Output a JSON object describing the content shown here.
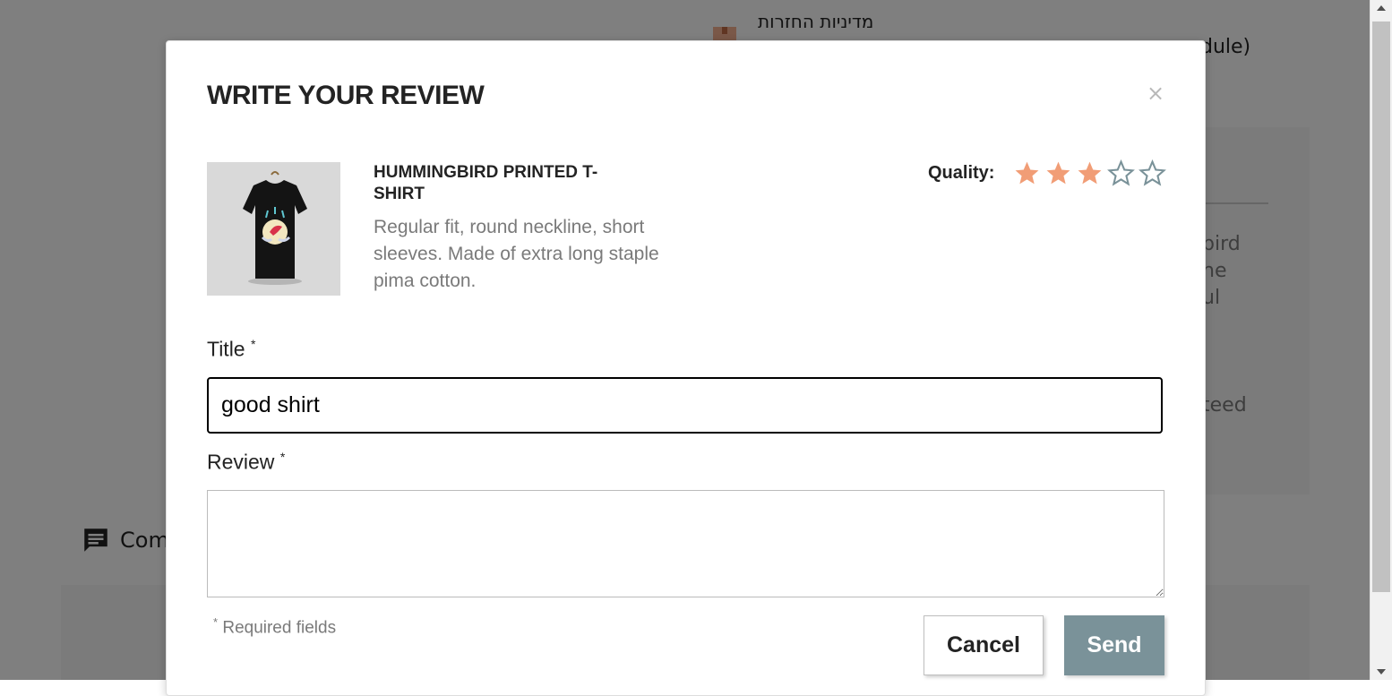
{
  "background": {
    "policy_text": "מדיניות החזרות",
    "module_text": "dule)",
    "card_text_lines": "bird\nne\nul",
    "card_text_2": "teed",
    "comments_label": "Com"
  },
  "modal": {
    "title": "WRITE YOUR REVIEW",
    "close_label": "×",
    "product": {
      "name": "HUMMINGBIRD PRINTED T-SHIRT",
      "description": "Regular fit, round neckline, short sleeves. Made of extra long staple pima cotton."
    },
    "quality": {
      "label": "Quality:",
      "rating": 3,
      "max": 5,
      "filled_color": "#f19d76",
      "empty_color": "#7a9299"
    },
    "title_field": {
      "label": "Title",
      "required_mark": "*",
      "value": "good shirt"
    },
    "review_field": {
      "label": "Review",
      "required_mark": "*",
      "value": ""
    },
    "required_note": {
      "mark": "*",
      "text": " Required fields"
    },
    "buttons": {
      "cancel": "Cancel",
      "send": "Send"
    }
  },
  "colors": {
    "overlay": "rgba(0,0,0,0.5)",
    "send_button": "#7a9299"
  }
}
